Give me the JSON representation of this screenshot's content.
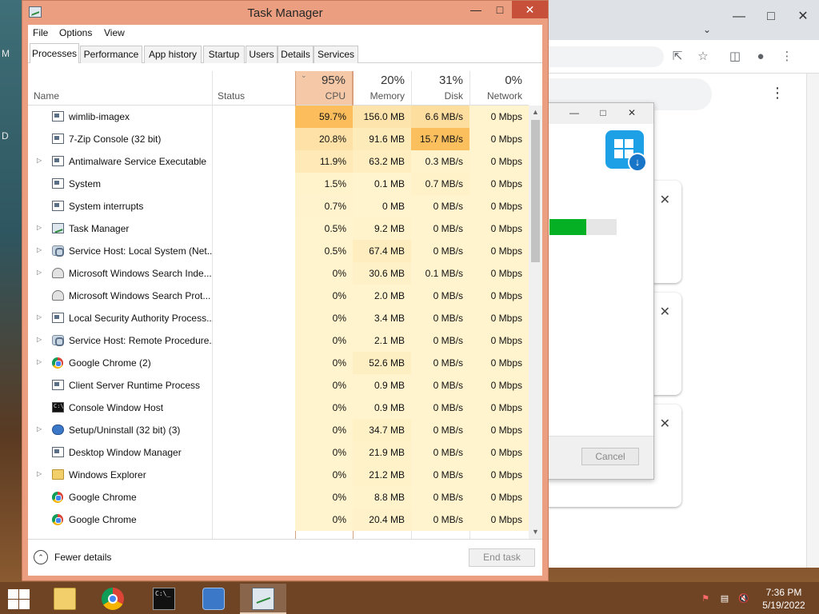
{
  "window": {
    "title": "Task Manager"
  },
  "menu": [
    "File",
    "Options",
    "View"
  ],
  "tabs": [
    "Processes",
    "Performance",
    "App history",
    "Startup",
    "Users",
    "Details",
    "Services"
  ],
  "columns": {
    "name": "Name",
    "status": "Status",
    "cpu": {
      "pct": "95%",
      "label": "CPU"
    },
    "memory": {
      "pct": "20%",
      "label": "Memory"
    },
    "disk": {
      "pct": "31%",
      "label": "Disk"
    },
    "network": {
      "pct": "0%",
      "label": "Network"
    }
  },
  "processes": [
    {
      "name": "wimlib-imagex",
      "icon": "window-icon",
      "expandable": false,
      "cpu": "59.7%",
      "memory": "156.0 MB",
      "disk": "6.6 MB/s",
      "network": "0 Mbps"
    },
    {
      "name": "7-Zip Console (32 bit)",
      "icon": "window-icon",
      "expandable": false,
      "cpu": "20.8%",
      "memory": "91.6 MB",
      "disk": "15.7 MB/s",
      "network": "0 Mbps"
    },
    {
      "name": "Antimalware Service Executable",
      "icon": "window-icon",
      "expandable": true,
      "cpu": "11.9%",
      "memory": "63.2 MB",
      "disk": "0.3 MB/s",
      "network": "0 Mbps"
    },
    {
      "name": "System",
      "icon": "window-icon",
      "expandable": false,
      "cpu": "1.5%",
      "memory": "0.1 MB",
      "disk": "0.7 MB/s",
      "network": "0 Mbps"
    },
    {
      "name": "System interrupts",
      "icon": "window-icon",
      "expandable": false,
      "cpu": "0.7%",
      "memory": "0 MB",
      "disk": "0 MB/s",
      "network": "0 Mbps"
    },
    {
      "name": "Task Manager",
      "icon": "task-manager-icon",
      "expandable": true,
      "cpu": "0.5%",
      "memory": "9.2 MB",
      "disk": "0 MB/s",
      "network": "0 Mbps"
    },
    {
      "name": "Service Host: Local System (Net...",
      "icon": "gear-icon",
      "expandable": true,
      "cpu": "0.5%",
      "memory": "67.4 MB",
      "disk": "0 MB/s",
      "network": "0 Mbps"
    },
    {
      "name": "Microsoft Windows Search Inde...",
      "icon": "user-icon",
      "expandable": true,
      "cpu": "0%",
      "memory": "30.6 MB",
      "disk": "0.1 MB/s",
      "network": "0 Mbps"
    },
    {
      "name": "Microsoft Windows Search Prot...",
      "icon": "user-icon",
      "expandable": false,
      "cpu": "0%",
      "memory": "2.0 MB",
      "disk": "0 MB/s",
      "network": "0 Mbps"
    },
    {
      "name": "Local Security Authority Process...",
      "icon": "window-icon",
      "expandable": true,
      "cpu": "0%",
      "memory": "3.4 MB",
      "disk": "0 MB/s",
      "network": "0 Mbps"
    },
    {
      "name": "Service Host: Remote Procedure...",
      "icon": "gear-icon",
      "expandable": true,
      "cpu": "0%",
      "memory": "2.1 MB",
      "disk": "0 MB/s",
      "network": "0 Mbps"
    },
    {
      "name": "Google Chrome (2)",
      "icon": "chrome-icon",
      "expandable": true,
      "cpu": "0%",
      "memory": "52.6 MB",
      "disk": "0 MB/s",
      "network": "0 Mbps"
    },
    {
      "name": "Client Server Runtime Process",
      "icon": "window-icon",
      "expandable": false,
      "cpu": "0%",
      "memory": "0.9 MB",
      "disk": "0 MB/s",
      "network": "0 Mbps"
    },
    {
      "name": "Console Window Host",
      "icon": "console-icon",
      "expandable": false,
      "cpu": "0%",
      "memory": "0.9 MB",
      "disk": "0 MB/s",
      "network": "0 Mbps"
    },
    {
      "name": "Setup/Uninstall (32 bit) (3)",
      "icon": "setup-icon",
      "expandable": true,
      "cpu": "0%",
      "memory": "34.7 MB",
      "disk": "0 MB/s",
      "network": "0 Mbps"
    },
    {
      "name": "Desktop Window Manager",
      "icon": "window-icon",
      "expandable": false,
      "cpu": "0%",
      "memory": "21.9 MB",
      "disk": "0 MB/s",
      "network": "0 Mbps"
    },
    {
      "name": "Windows Explorer",
      "icon": "folder-icon",
      "expandable": true,
      "cpu": "0%",
      "memory": "21.2 MB",
      "disk": "0 MB/s",
      "network": "0 Mbps"
    },
    {
      "name": "Google Chrome",
      "icon": "chrome-icon",
      "expandable": false,
      "cpu": "0%",
      "memory": "8.8 MB",
      "disk": "0 MB/s",
      "network": "0 Mbps"
    },
    {
      "name": "Google Chrome",
      "icon": "chrome-icon",
      "expandable": false,
      "cpu": "0%",
      "memory": "20.4 MB",
      "disk": "0 MB/s",
      "network": "0 Mbps"
    }
  ],
  "footer": {
    "fewer_details": "Fewer details",
    "end_task": "End task"
  },
  "installer": {
    "cancel_label": "Cancel",
    "progress_fraction": 0.55
  },
  "desktop_letters": [
    "M",
    "D"
  ],
  "taskbar": {
    "time": "7:36 PM",
    "date": "5/19/2022"
  },
  "colors": {
    "titlebar": "#eb9f80",
    "close_button": "#c7503a",
    "cpu_header": "#f5c9a8",
    "progress": "#06b025"
  }
}
